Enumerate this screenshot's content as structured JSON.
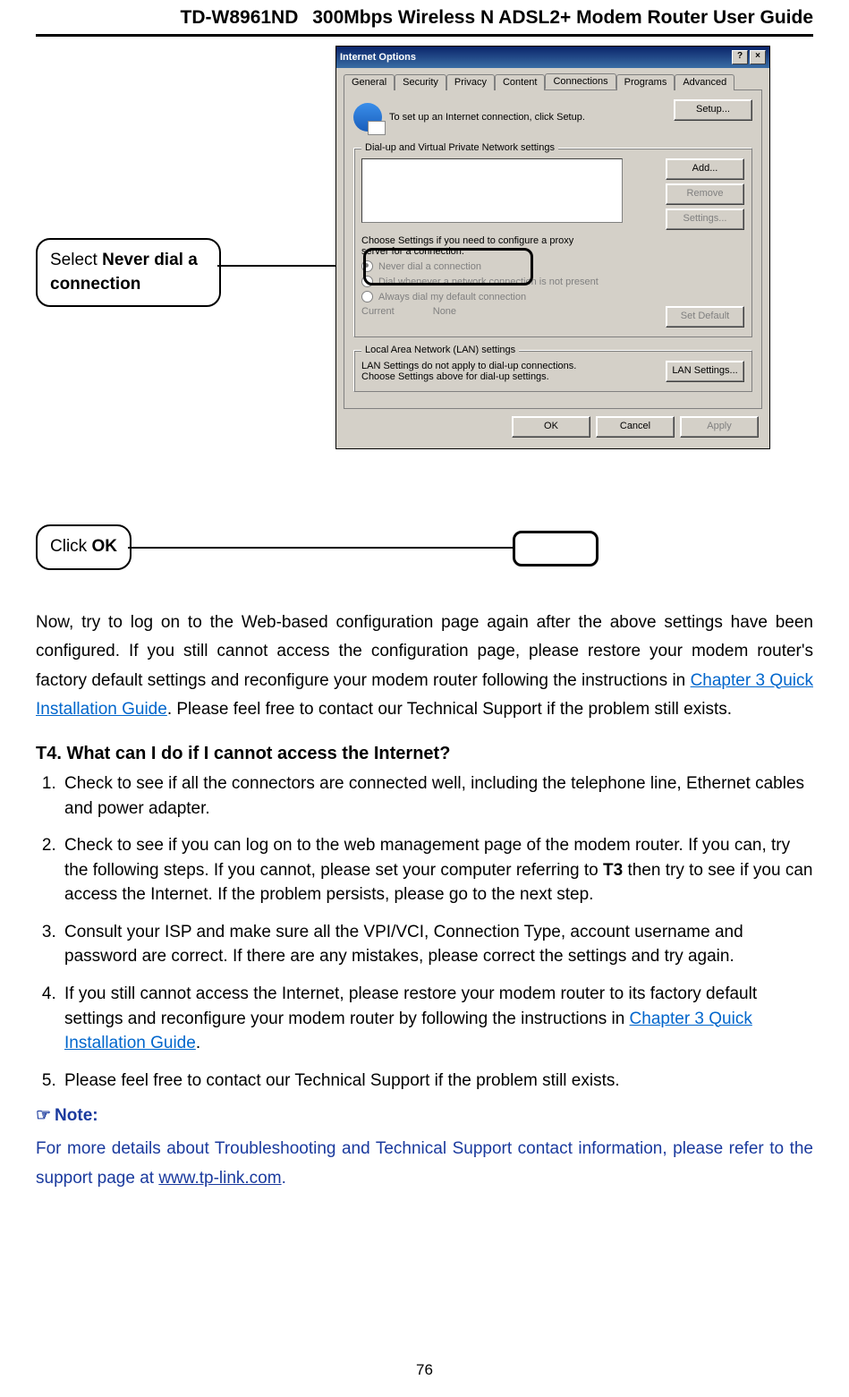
{
  "header": {
    "model": "TD-W8961ND",
    "title": "300Mbps Wireless N ADSL2+ Modem Router User Guide"
  },
  "callouts": {
    "never_dial_prefix": "Select ",
    "never_dial_bold": "Never dial a",
    "never_dial_line2": "connection",
    "click_ok_prefix": "Click ",
    "click_ok_bold": "OK"
  },
  "dialog": {
    "title": "Internet Options",
    "help_icon": "?",
    "close_icon": "×",
    "tabs": [
      "General",
      "Security",
      "Privacy",
      "Content",
      "Connections",
      "Programs",
      "Advanced"
    ],
    "active_tab": "Connections",
    "setup_text": "To set up an Internet connection, click Setup.",
    "setup_button": "Setup...",
    "group_dialup": "Dial-up and Virtual Private Network settings",
    "add_button": "Add...",
    "remove_button": "Remove",
    "settings_button": "Settings...",
    "proxy_text1": "Choose Settings if you need to configure a proxy",
    "proxy_text2": "server for a connection.",
    "radio1": "Never dial a connection",
    "radio2": "Dial whenever a network connection is not present",
    "radio3": "Always dial my default connection",
    "current_label": "Current",
    "current_value": "None",
    "setdefault_button": "Set Default",
    "group_lan": "Local Area Network (LAN) settings",
    "lan_text": "LAN Settings do not apply to dial-up connections. Choose Settings above for dial-up settings.",
    "lansettings_button": "LAN Settings...",
    "ok_button": "OK",
    "cancel_button": "Cancel",
    "apply_button": "Apply"
  },
  "paragraph": {
    "p1a": "Now, try to log on to the Web-based configuration page again after the above settings have been configured. If you still cannot access the configuration page, please restore your modem router's factory default settings and reconfigure your modem router following the instructions in ",
    "p1_link": "Chapter 3 Quick Installation Guide",
    "p1b": ". Please feel free to contact our Technical Support if the problem still exists."
  },
  "section_t4": "T4. What can I do if I cannot access the Internet?",
  "steps": {
    "s1": "Check to see if all the connectors are connected well, including the telephone line, Ethernet cables and power adapter.",
    "s2a": "Check to see if you can log on to the web management page of the modem router. If you can, try the following steps. If you cannot, please set your computer referring to ",
    "s2_bold": "T3",
    "s2b": " then try to see if you can access the Internet. If the problem persists, please go to the next step.",
    "s3": "Consult your ISP and make sure all the VPI/VCI, Connection Type, account username and password are correct. If there are any mistakes, please correct the settings and try again.",
    "s4a": "If you still cannot access the Internet, please restore your modem router to its factory default settings and reconfigure your modem router by following the instructions in ",
    "s4_link": "Chapter 3 Quick Installation Guide",
    "s4b": ".",
    "s5": "Please feel free to contact our Technical Support if the problem still exists."
  },
  "note": {
    "hand": "☞",
    "label": "Note:",
    "text_a": "For more details about Troubleshooting and Technical Support contact information, please refer to the support page at ",
    "link": "www.tp-link.com",
    "text_b": "."
  },
  "page_number": "76"
}
